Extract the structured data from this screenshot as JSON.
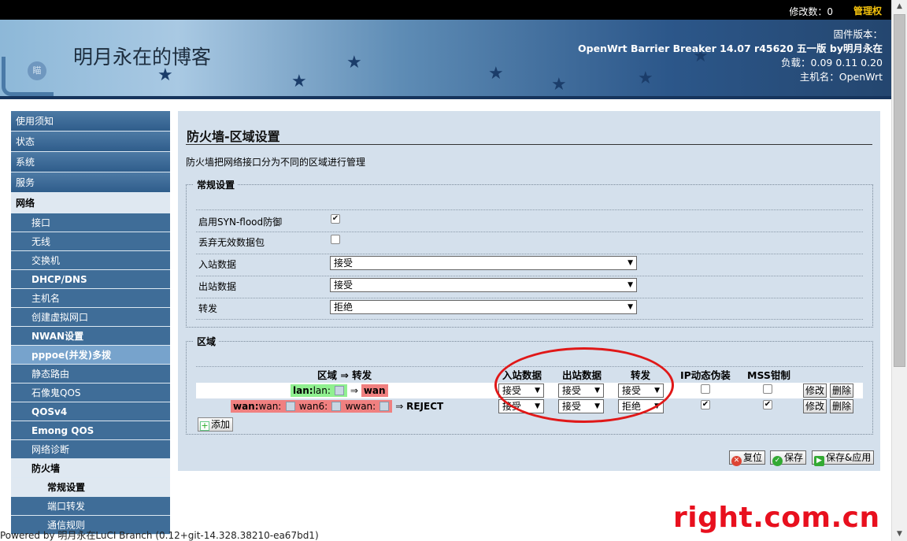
{
  "topbar": {
    "changes_label": "修改数：0",
    "admin_label": "管理权"
  },
  "header": {
    "site_title": "明月永在的博客",
    "firmware_label": "固件版本：",
    "firmware_value": "OpenWrt Barrier Breaker 14.07 r45620 五一版 by明月永在",
    "load": "负载：0.09 0.11 0.20",
    "hostname": "主机名：OpenWrt"
  },
  "sidebar": {
    "items": [
      "使用须知",
      "状态",
      "系统",
      "服务"
    ],
    "active_item": "网络",
    "network_sub": [
      "接口",
      "无线",
      "交换机",
      "DHCP/DNS",
      "主机名",
      "创建虚拟网口",
      "NWAN设置",
      "pppoe(并发)多拨",
      "静态路由",
      "石像鬼QOS",
      "QOSv4",
      "Emong QOS",
      "网络诊断"
    ],
    "active_sub": "防火墙",
    "firewall_sub": [
      "常规设置",
      "端口转发",
      "通信规则"
    ]
  },
  "main": {
    "title": "防火墙-区域设置",
    "description": "防火墙把网络接口分为不同的区域进行管理",
    "general": {
      "legend": "常规设置",
      "syn_label": "启用SYN-flood防御",
      "drop_label": "丢弃无效数据包",
      "input_label": "入站数据",
      "input_value": "接受",
      "output_label": "出站数据",
      "output_value": "接受",
      "forward_label": "转发",
      "forward_value": "拒绝"
    },
    "zones": {
      "legend": "区域",
      "headers": {
        "zone": "区域 ⇒ 转发",
        "input": "入站数据",
        "output": "出站数据",
        "forward": "转发",
        "masq": "IP动态伪装",
        "mss": "MSS钳制"
      },
      "rows": [
        {
          "zone": "lan:",
          "ifaces": "lan:",
          "arrow": "⇒",
          "target": "wan",
          "input": "接受",
          "output": "接受",
          "forward": "接受",
          "masq": false,
          "mss": false
        },
        {
          "zone": "wan:",
          "ifaces": "wan:",
          "iface2": "wan6:",
          "iface3": "wwan:",
          "arrow": "⇒",
          "target": "REJECT",
          "input": "接受",
          "output": "接受",
          "forward": "拒绝",
          "masq": true,
          "mss": true
        }
      ],
      "edit_label": "修改",
      "delete_label": "删除",
      "add_label": "添加"
    },
    "actions": {
      "reset": "复位",
      "save": "保存",
      "save_apply": "保存&应用"
    }
  },
  "footer": "Powered by 明月永在LuCI Branch (0.12+git-14.328.38210-ea67bd1)",
  "watermark": "right.com.cn",
  "colors": {
    "accent_red": "#e01818",
    "lan_green": "#90f090",
    "wan_red": "#f08080",
    "nav_blue": "#3f6d98"
  }
}
